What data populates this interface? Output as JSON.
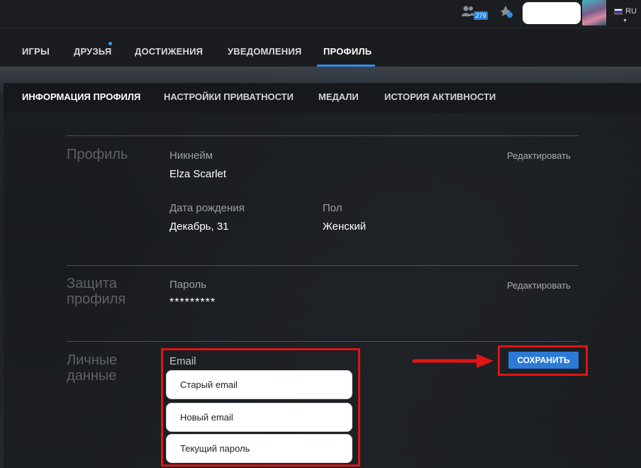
{
  "topbar": {
    "friends_count": "279",
    "language": "RU",
    "flag_colors": [
      "#ffffff",
      "#1c3fbf",
      "#d52b1e"
    ]
  },
  "main_nav": {
    "tabs": [
      {
        "label": "ИГРЫ"
      },
      {
        "label": "ДРУЗЬЯ"
      },
      {
        "label": "ДОСТИЖЕНИЯ"
      },
      {
        "label": "УВЕДОМЛЕНИЯ"
      },
      {
        "label": "ПРОФИЛЬ",
        "active": true
      }
    ]
  },
  "sub_nav": {
    "tabs": [
      {
        "label": "ИНФОРМАЦИЯ ПРОФИЛЯ",
        "active": true
      },
      {
        "label": "НАСТРОЙКИ ПРИВАТНОСТИ"
      },
      {
        "label": "МЕДАЛИ"
      },
      {
        "label": "ИСТОРИЯ АКТИВНОСТИ"
      }
    ]
  },
  "profile": {
    "title": "Профиль",
    "edit_label": "Редактировать",
    "nickname_label": "Никнейм",
    "nickname_value": "Elza Scarlet",
    "birthday_label": "Дата рождения",
    "birthday_value": "Декабрь, 31",
    "gender_label": "Пол",
    "gender_value": "Женский"
  },
  "security": {
    "title_line1": "Защита",
    "title_line2": "профиля",
    "edit_label": "Редактировать",
    "password_label": "Пароль",
    "password_value": "*********"
  },
  "personal": {
    "title_line1": "Личные",
    "title_line2": "данные",
    "email_label": "Email",
    "old_email_placeholder": "Старый email",
    "new_email_placeholder": "Новый email",
    "current_password_placeholder": "Текущий пароль",
    "save_label": "СОХРАНИТЬ"
  },
  "colors": {
    "accent": "#2f8eea",
    "highlight": "#e01414"
  }
}
